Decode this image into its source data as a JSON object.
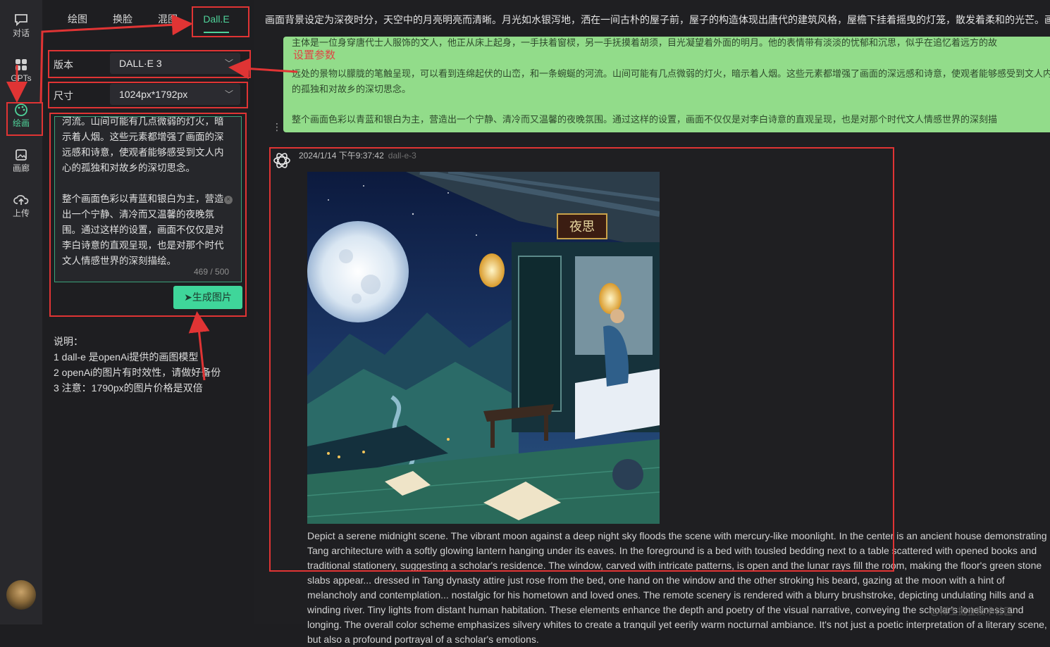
{
  "rail": {
    "items": [
      {
        "label": "对话",
        "icon": "chat-icon"
      },
      {
        "label": "GPTs",
        "icon": "grid-icon"
      },
      {
        "label": "绘画",
        "icon": "palette-icon",
        "active": true
      },
      {
        "label": "画廊",
        "icon": "image-icon"
      },
      {
        "label": "上传",
        "icon": "upload-cloud-icon"
      }
    ]
  },
  "tabs": [
    "绘图",
    "换脸",
    "混图",
    "Dall.E"
  ],
  "active_tab": "Dall.E",
  "form": {
    "version_label": "版本",
    "version_value": "DALL·E 3",
    "size_label": "尺寸",
    "size_value": "1024px*1792px",
    "prompt_text": "河流。山间可能有几点微弱的灯火，暗示着人烟。这些元素都增强了画面的深远感和诗意，使观者能够感受到文人内心的孤独和对故乡的深切思念。\n\n整个画面色彩以青蓝和银白为主，营造出一个宁静、清冷而又温馨的夜晚氛围。通过这样的设置，画面不仅仅是对李白诗意的直观呈现，也是对那个时代文人情感世界的深刻描绘。",
    "counter": "469 / 500",
    "generate_label": "生成图片"
  },
  "notes": {
    "title": "说明：",
    "lines": [
      "1 dall-e 是openAi提供的画图模型",
      "2 openAi的图片有时效性，请做好备份",
      "3 注意：1790px的图片价格是双倍"
    ]
  },
  "main": {
    "top_text": "画面背景设定为深夜时分，天空中的月亮明亮而清晰。月光如水银泻地，洒在一间古朴的屋子前，屋子的构造体现出唐代的建筑风格，屋檐下挂着摇曳的灯笼，散发着柔和的光芒。画",
    "green_line0": "主体是一位身穿唐代士人服饰的文人，他正从床上起身，一手扶着窗棂，另一手抚摸着胡须，目光凝望着外面的明月。他的表情带有淡淡的忧郁和沉思，似乎在追忆着远方的故",
    "green_heading": "设置参数",
    "green_p1": "远处的景物以朦胧的笔触呈现，可以看到连绵起伏的山峦，和一条蜿蜒的河流。山间可能有几点微弱的灯火，暗示着人烟。这些元素都增强了画面的深远感和诗意，使观者能够感受到文人内心的孤独和对故乡的深切思念。",
    "green_p2": "整个画面色彩以青蓝和银白为主，营造出一个宁静、清冷而又温馨的夜晚氛围。通过这样的设置，画面不仅仅是对李白诗意的直观呈现，也是对那个时代文人情感世界的深刻描",
    "meta_time": "2024/1/14 下午9:37:42",
    "meta_model": "dall-e-3",
    "art_plaque": "夜思",
    "description": "Depict a serene midnight scene. The vibrant moon against a deep night sky floods the scene with mercury-like moonlight. In the center is an ancient house demonstrating Tang architecture with a softly glowing lantern hanging under its eaves. In the foreground is a bed with tousled bedding next to a table scattered with opened books and traditional stationery, suggesting a scholar's residence. The window, carved with intricate patterns, is open and the lunar rays fill the room, making the floor's green stone slabs appear... dressed in Tang dynasty attire just rose from the bed, one hand on the window and the other stroking his beard, gazing at the moon with a hint of melancholy and contemplation... nostalgic for his hometown and loved ones. The remote scenery is rendered with a blurry brushstroke, depicting undulating hills and a winding river. Tiny lights from distant human habitation. These elements enhance the depth and poetry of the visual narrative, conveying the scholar's loneliness and longing. The overall color scheme emphasizes silvery whites to create a tranquil yet eerily warm nocturnal ambiance. It's not just a poetic interpretation of a literary scene, but also a profound portrayal of a scholar's emotions.",
    "watermark": "@稀土掘金技术社区"
  },
  "colors": {
    "accent": "#4fd39a",
    "annotation": "#e03434",
    "green_bubble": "#92dc8a"
  }
}
